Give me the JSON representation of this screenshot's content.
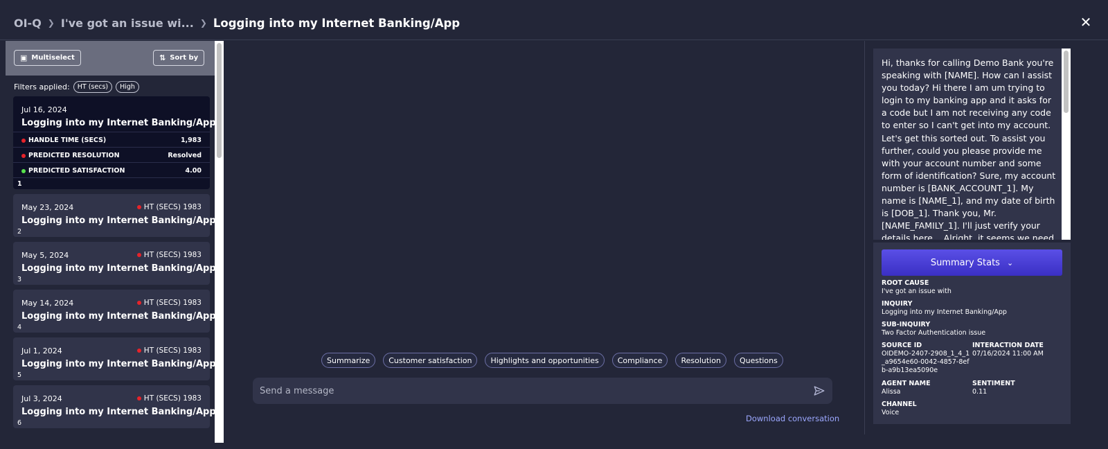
{
  "breadcrumb": {
    "root": "OI-Q",
    "parent": "I've got an issue wi...",
    "current": "Logging into my Internet Banking/App"
  },
  "toolbar": {
    "multiselect_label": "Multiselect",
    "sort_label": "Sort by"
  },
  "filters": {
    "label": "Filters applied:",
    "chips": [
      "HT (secs)",
      "High"
    ]
  },
  "selected_card": {
    "date": "Jul 16, 2024",
    "title": "Logging into my Internet Banking/App",
    "metrics": [
      {
        "label": "HANDLE TIME (SECS)",
        "value": "1,983",
        "status": "red"
      },
      {
        "label": "PREDICTED RESOLUTION",
        "value": "Resolved",
        "status": "red"
      },
      {
        "label": "PREDICTED SATISFACTION",
        "value": "4.00",
        "status": "green"
      }
    ],
    "index": "1"
  },
  "cards": [
    {
      "date": "May 23, 2024",
      "badge": "HT (SECS) 1983",
      "title": "Logging into my Internet Banking/App",
      "index": "2"
    },
    {
      "date": "May 5, 2024",
      "badge": "HT (SECS) 1983",
      "title": "Logging into my Internet Banking/App",
      "index": "3"
    },
    {
      "date": "May 14, 2024",
      "badge": "HT (SECS) 1983",
      "title": "Logging into my Internet Banking/App",
      "index": "4"
    },
    {
      "date": "Jul 1, 2024",
      "badge": "HT (SECS) 1983",
      "title": "Logging into my Internet Banking/App",
      "index": "5"
    },
    {
      "date": "Jul 3, 2024",
      "badge": "HT (SECS) 1983",
      "title": "Logging into my Internet Banking/App",
      "index": "6"
    }
  ],
  "suggestions": [
    "Summarize",
    "Customer satisfaction",
    "Highlights and opportunities",
    "Compliance",
    "Resolution",
    "Questions"
  ],
  "message": {
    "placeholder": "Send a message",
    "value": ""
  },
  "download_label": "Download conversation",
  "transcript": "Hi, thanks for calling Demo Bank you're speaking with [NAME]. How can I assist you today? Hi there I am um trying to login to my banking app and it asks for a code but I am not receiving any code to enter so I can't get into my account. Let's get this sorted out. To assist you further, could you please provide me with your account number and some form of identification? Sure, my account number is [BANK_ACCOUNT_1]. My name is [NAME_1], and my date of birth is [DOB_1]. Thank you, Mr. [NAME_FAMILY_1]. I'll just verify your details here... Alright, it seems we need",
  "summary": {
    "button_label": "Summary Stats",
    "root_cause_label": "ROOT CAUSE",
    "root_cause": "I've got an issue with",
    "inquiry_label": "INQUIRY",
    "inquiry": "Logging into my Internet Banking/App",
    "sub_inquiry_label": "SUB-INQUIRY",
    "sub_inquiry": "Two Factor Authentication issue",
    "source_id_label": "SOURCE ID",
    "source_id": "OIDEMO-2407-2908_1_4_1_a9654e60-0042-4857-8efb-a9b13ea5090e",
    "interaction_date_label": "INTERACTION DATE",
    "interaction_date": "07/16/2024 11:00 AM",
    "agent_name_label": "AGENT NAME",
    "agent_name": "Alissa",
    "sentiment_label": "SENTIMENT",
    "sentiment": "0.11",
    "channel_label": "CHANNEL",
    "channel": "Voice"
  },
  "colors": {
    "background": "#232638",
    "card": "#31344a",
    "selected_card": "#0e1026",
    "accent": "#4a3fd8",
    "link": "#9ca8ff",
    "status_red": "#e6232a",
    "status_green": "#57e04c"
  }
}
